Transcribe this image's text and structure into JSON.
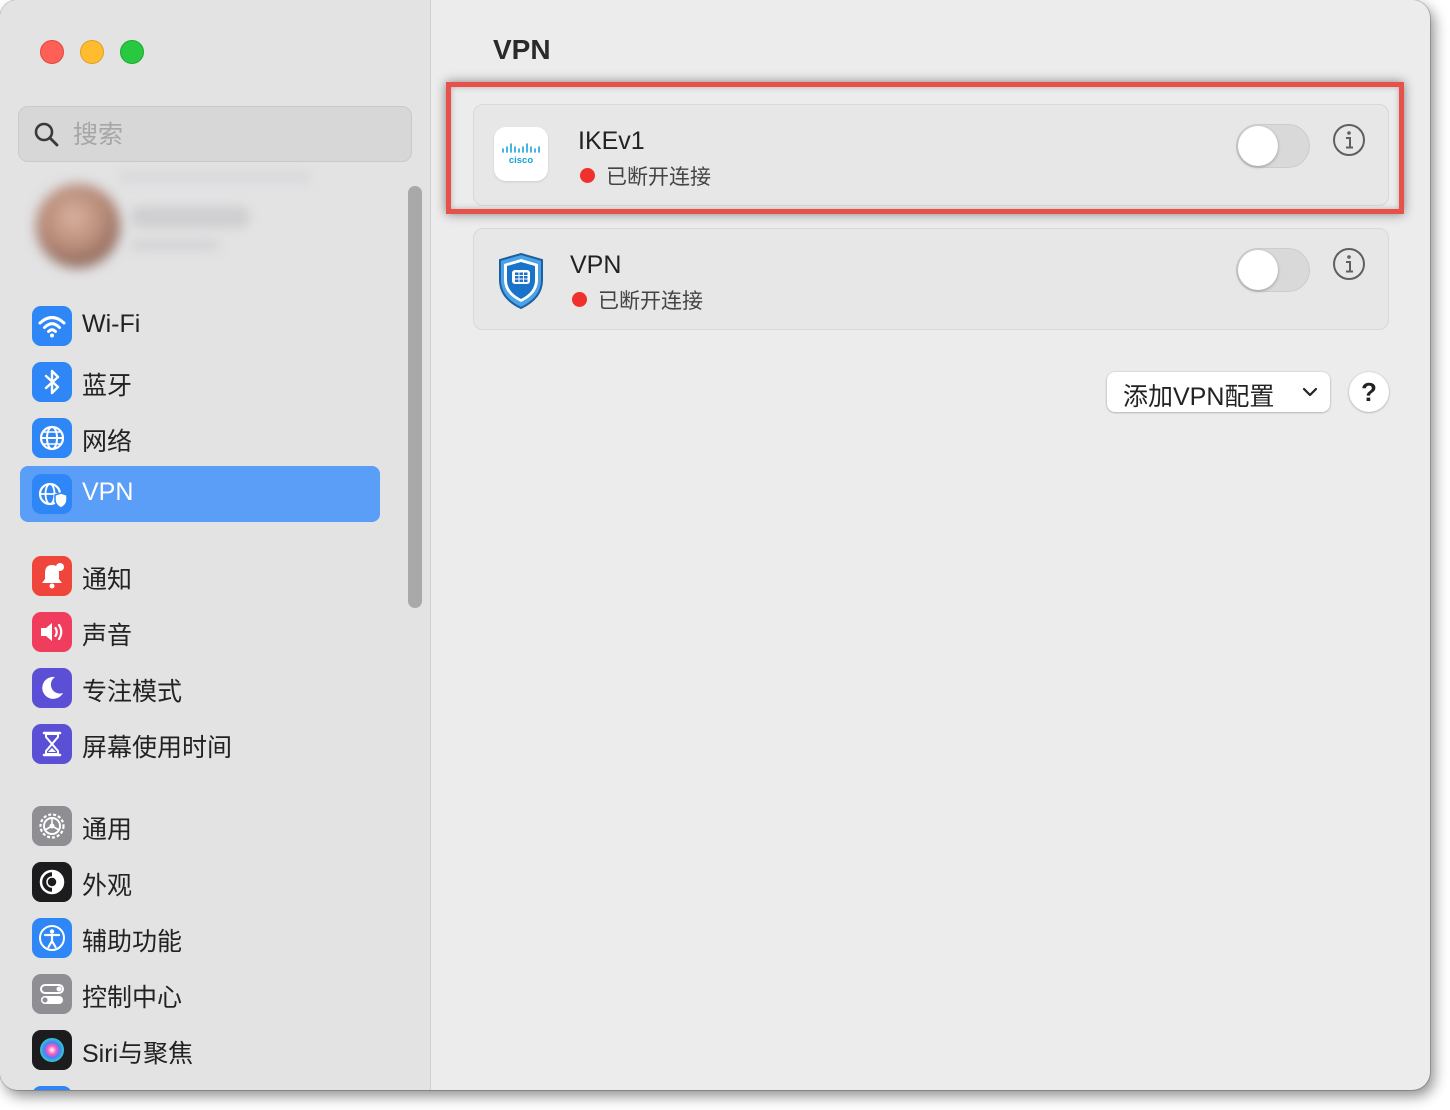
{
  "window": {
    "title": "VPN",
    "traffic_lights": [
      "close",
      "minimize",
      "maximize"
    ]
  },
  "sidebar": {
    "search": {
      "placeholder": "搜索",
      "value": ""
    },
    "selected": "VPN",
    "groups": [
      [
        {
          "label": "Wi-Fi",
          "icon": "wifi-icon",
          "color": "#2f86f6"
        },
        {
          "label": "蓝牙",
          "icon": "bluetooth-icon",
          "color": "#2f86f6"
        },
        {
          "label": "网络",
          "icon": "globe-icon",
          "color": "#2f86f6"
        },
        {
          "label": "VPN",
          "icon": "vpn-globe-icon",
          "color": "#2f86f6"
        }
      ],
      [
        {
          "label": "通知",
          "icon": "bell-icon",
          "color": "#f0453a"
        },
        {
          "label": "声音",
          "icon": "speaker-icon",
          "color": "#f03d5e"
        },
        {
          "label": "专注模式",
          "icon": "moon-icon",
          "color": "#5b4fd6"
        },
        {
          "label": "屏幕使用时间",
          "icon": "hourglass-icon",
          "color": "#5b4fd6"
        }
      ],
      [
        {
          "label": "通用",
          "icon": "gear-icon",
          "color": "#8e8e93"
        },
        {
          "label": "外观",
          "icon": "appearance-icon",
          "color": "#1c1c1e"
        },
        {
          "label": "辅助功能",
          "icon": "accessibility-icon",
          "color": "#2f86f6"
        },
        {
          "label": "控制中心",
          "icon": "control-center-icon",
          "color": "#8e8e93"
        },
        {
          "label": "Siri与聚焦",
          "icon": "siri-icon",
          "color": "#1c1c1e"
        }
      ]
    ]
  },
  "main": {
    "title": "VPN",
    "vpns": [
      {
        "name": "IKEv1",
        "status": "已断开连接",
        "status_color": "#f0302a",
        "enabled": false,
        "logo": "cisco-logo",
        "logo_text": "cisco"
      },
      {
        "name": "VPN",
        "status": "已断开连接",
        "status_color": "#f0302a",
        "enabled": false,
        "logo": "fortinet-shield-logo"
      }
    ],
    "add_button": {
      "label": "添加VPN配置"
    },
    "help_button": {
      "label": "?"
    }
  },
  "annotation": {
    "highlight_color": "#e8504a",
    "target": "IKEv1"
  }
}
